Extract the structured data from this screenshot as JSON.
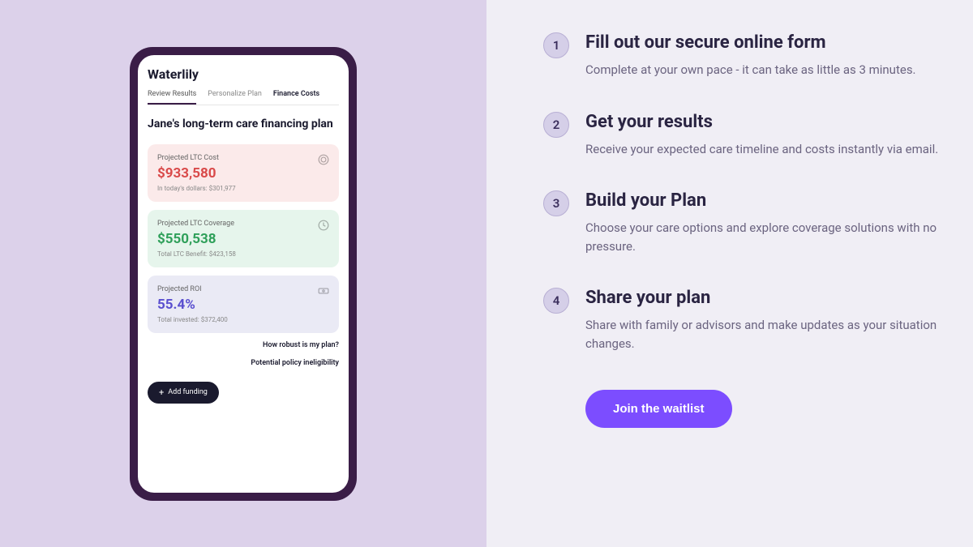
{
  "phone": {
    "app_title": "Waterlily",
    "tabs": [
      "Review Results",
      "Personalize Plan",
      "Finance Costs"
    ],
    "plan_title": "Jane's long-term care financing plan",
    "cards": [
      {
        "label": "Projected LTC Cost",
        "value": "$933,580",
        "sub": "In today's dollars: $301,977"
      },
      {
        "label": "Projected LTC Coverage",
        "value": "$550,538",
        "sub": "Total LTC Benefit: $423,158"
      },
      {
        "label": "Projected ROI",
        "value": "55.4%",
        "sub": "Total invested: $372,400"
      }
    ],
    "links": [
      "How robust is my plan?",
      "Potential policy ineligibility"
    ],
    "add_button": "Add funding"
  },
  "steps": [
    {
      "num": "1",
      "title": "Fill out our secure online form",
      "desc": "Complete at your own pace - it can take as little as 3 minutes."
    },
    {
      "num": "2",
      "title": "Get your results",
      "desc": "Receive your expected care timeline and costs instantly via email."
    },
    {
      "num": "3",
      "title": "Build your Plan",
      "desc": "Choose your care options and explore coverage solutions with no pressure."
    },
    {
      "num": "4",
      "title": "Share your plan",
      "desc": "Share with family or advisors and make updates as your situation changes."
    }
  ],
  "cta": "Join the waitlist"
}
